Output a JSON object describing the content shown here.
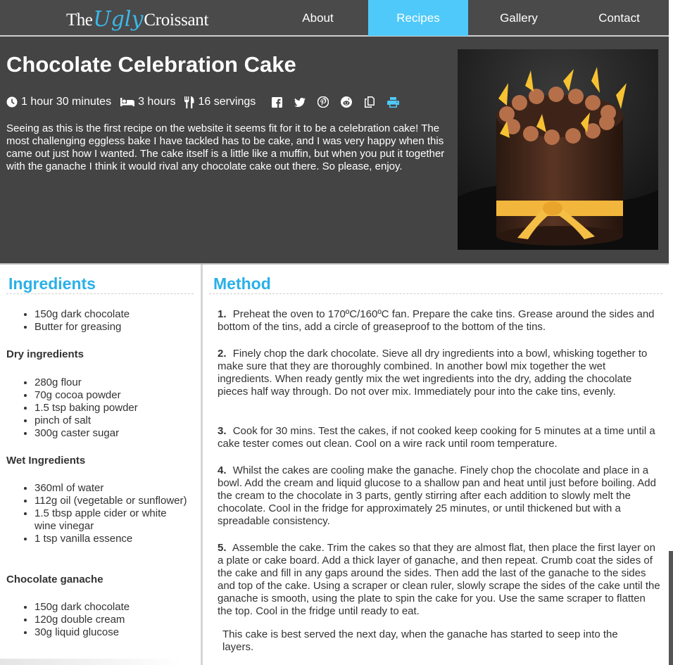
{
  "nav": {
    "logo": {
      "the": "The",
      "ugly": "Ugly",
      "croissant": "Croissant"
    },
    "items": [
      {
        "label": "About"
      },
      {
        "label": "Recipes"
      },
      {
        "label": "Gallery"
      },
      {
        "label": "Contact"
      }
    ],
    "active": "Recipes",
    "active_color": "#4fc9fa"
  },
  "recipe": {
    "title": "Chocolate Celebration Cake",
    "prep_time": "1 hour 30 minutes",
    "rest_time": "3 hours",
    "servings": "16 servings",
    "meta_icons": [
      "clock-icon",
      "bed-icon",
      "cutlery-icon"
    ],
    "share_icons": [
      "facebook-icon",
      "twitter-icon",
      "pinterest-icon",
      "reddit-icon",
      "copy-icon",
      "print-icon"
    ],
    "intro": "Seeing as this is the first recipe on the website it seems fit for it to be a celebration cake! The most challenging eggless bake I have tackled has to be cake, and I was very happy when this came out just how I wanted. The cake itself is a little like a muffin, but when you put it together with the ganache I think it would rival any chocolate cake out there. So please, enjoy."
  },
  "ingredients": {
    "heading": "Ingredients",
    "base": [
      "150g dark chocolate",
      "Butter for greasing"
    ],
    "dry_heading": "Dry ingredients",
    "dry": [
      "280g flour",
      "70g cocoa powder",
      "1.5 tsp baking powder",
      "pinch of salt",
      "300g caster sugar"
    ],
    "wet_heading": "Wet Ingredients",
    "wet": [
      "360ml of water",
      "112g oil (vegetable or sunflower)",
      "1.5 tbsp apple cider or white wine vinegar",
      "1 tsp vanilla essence"
    ],
    "ganache_heading": "Chocolate ganache",
    "ganache": [
      "150g dark chocolate",
      "120g double cream",
      "30g liquid glucose"
    ]
  },
  "method": {
    "heading": "Method",
    "steps": [
      {
        "num": "1.",
        "text": "Preheat the oven to 170ºC/160ºC fan. Prepare the cake tins. Grease around the sides and bottom of the tins, add a circle of greaseproof to the bottom of the tins."
      },
      {
        "num": "2.",
        "text": "Finely chop the dark chocolate. Sieve all dry ingredients into a bowl, whisking together to make sure that they are thoroughly combined. In another bowl mix together the wet ingredients. When ready gently mix the wet ingredients into the dry, adding the chocolate pieces half way through. Do not over mix. Immediately pour into the cake tins, evenly."
      },
      {
        "num": "3.",
        "text": "Cook for 30 mins. Test the cakes, if not cooked keep cooking for 5 minutes at a time until a cake tester comes out clean. Cool on a wire rack until room temperature."
      },
      {
        "num": "4.",
        "text": "Whilst the cakes are cooling make the ganache. Finely chop the chocolate and place in a bowl. Add the cream and liquid glucose to a shallow pan and heat until just before boiling. Add the cream to the chocolate in 3 parts, gently stirring after each addition to slowly melt the chocolate. Cool in the fridge for approximately 25 minutes, or until thickened but with a spreadable consistency."
      },
      {
        "num": "5.",
        "text": "Assemble the cake. Trim the cakes so that they are almost flat, then place the first layer on a plate or cake board. Add a thick layer of ganache, and then repeat. Crumb coat the sides of the cake and fill in any gaps around the sides. Then add the last of the ganache to the sides and top of the cake. Using a scraper or clean ruler, slowly scrape the sides of the cake until the ganache is smooth, using the plate to spin the cake for you. Use the same scraper to flatten the top. Cool in the fridge until ready to eat."
      }
    ],
    "note": "This cake is best served the next day, when the ganache has started to seep into the layers."
  },
  "colors": {
    "background": "#444444",
    "accent": "#2bb0e8",
    "text_dark": "#333333"
  }
}
